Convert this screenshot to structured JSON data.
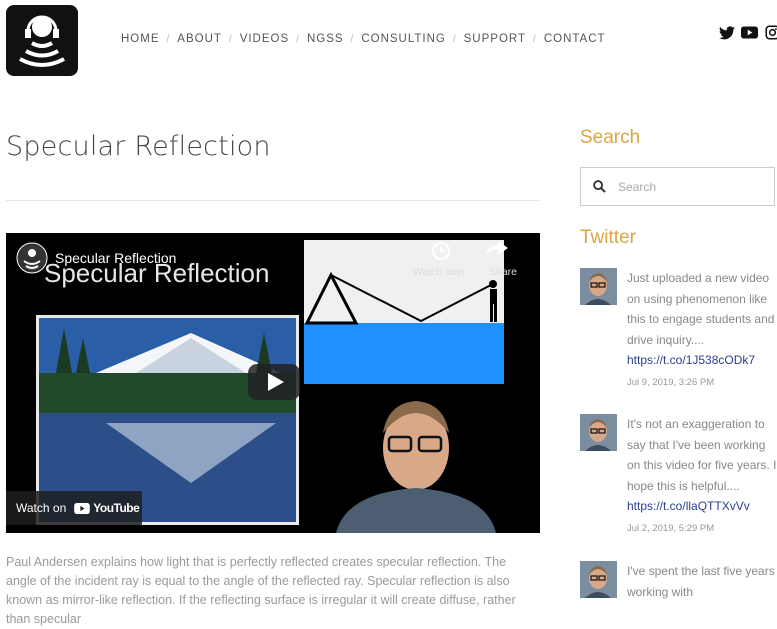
{
  "nav": {
    "items": [
      "HOME",
      "ABOUT",
      "VIDEOS",
      "NGSS",
      "CONSULTING",
      "SUPPORT",
      "CONTACT"
    ]
  },
  "social": [
    "twitter-icon",
    "youtube-icon",
    "instagram-icon"
  ],
  "page_title": "Specular Reflection",
  "video": {
    "channel_title": "Specular Reflection",
    "slide_title": "Specular Reflection",
    "watch_later": "Watch later",
    "share": "Share",
    "watch_on": "Watch on",
    "youtube": "YouTube"
  },
  "description": "Paul Andersen explains how light that is perfectly reflected creates specular reflection. The angle of the incident ray is equal to the angle of the reflected ray. Specular reflection is also known as mirror-like reflection. If the reflecting surface is irregular it will create diffuse, rather than specular",
  "sidebar": {
    "search_heading": "Search",
    "search_placeholder": "Search",
    "twitter_heading": "Twitter",
    "tweets": [
      {
        "text": "Just uploaded a new video on using phenomenon like this to engage students and drive inquiry....",
        "link": "https://t.co/1J538cODk7",
        "date": "Jul 9, 2019, 3:26 PM"
      },
      {
        "text": "It's not an exaggeration to say that I've been working on this video for five years. I hope this is helpful....",
        "link": "https://t.co/llaQTTXvVv",
        "date": "Jul 2, 2019, 5:29 PM"
      },
      {
        "text": "I've spent the last five years working with",
        "link": "",
        "date": ""
      }
    ]
  },
  "colors": {
    "accent": "#d9a546",
    "link": "#2a3f8f",
    "water": "#1e90ff"
  }
}
